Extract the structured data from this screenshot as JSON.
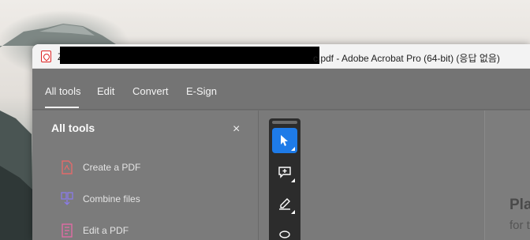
{
  "window": {
    "title_prefix": "Z",
    "title_suffix": "c.pdf - Adobe Acrobat Pro (64-bit) (응답 없음)"
  },
  "menu": {
    "items": [
      {
        "label": "All tools",
        "active": true
      },
      {
        "label": "Edit",
        "active": false
      },
      {
        "label": "Convert",
        "active": false
      },
      {
        "label": "E-Sign",
        "active": false
      }
    ]
  },
  "tools_panel": {
    "title": "All tools",
    "close_symbol": "×",
    "items": [
      {
        "label": "Create a PDF",
        "icon": "create-pdf-icon",
        "color": "#e26b6b"
      },
      {
        "label": "Combine files",
        "icon": "combine-files-icon",
        "color": "#8a7be8"
      },
      {
        "label": "Edit a PDF",
        "icon": "edit-pdf-icon",
        "color": "#e86ba8"
      }
    ]
  },
  "quick_toolbar": {
    "tools": [
      {
        "name": "select-tool",
        "icon": "cursor-icon",
        "active": true
      },
      {
        "name": "comment-tool",
        "icon": "add-comment-icon",
        "active": false
      },
      {
        "name": "highlight-tool",
        "icon": "pen-icon",
        "active": false
      },
      {
        "name": "draw-tool",
        "icon": "lasso-icon",
        "active": false
      }
    ],
    "accent_color": "#1e7be8"
  },
  "document": {
    "heading": "Pla",
    "subtext": "for t"
  }
}
